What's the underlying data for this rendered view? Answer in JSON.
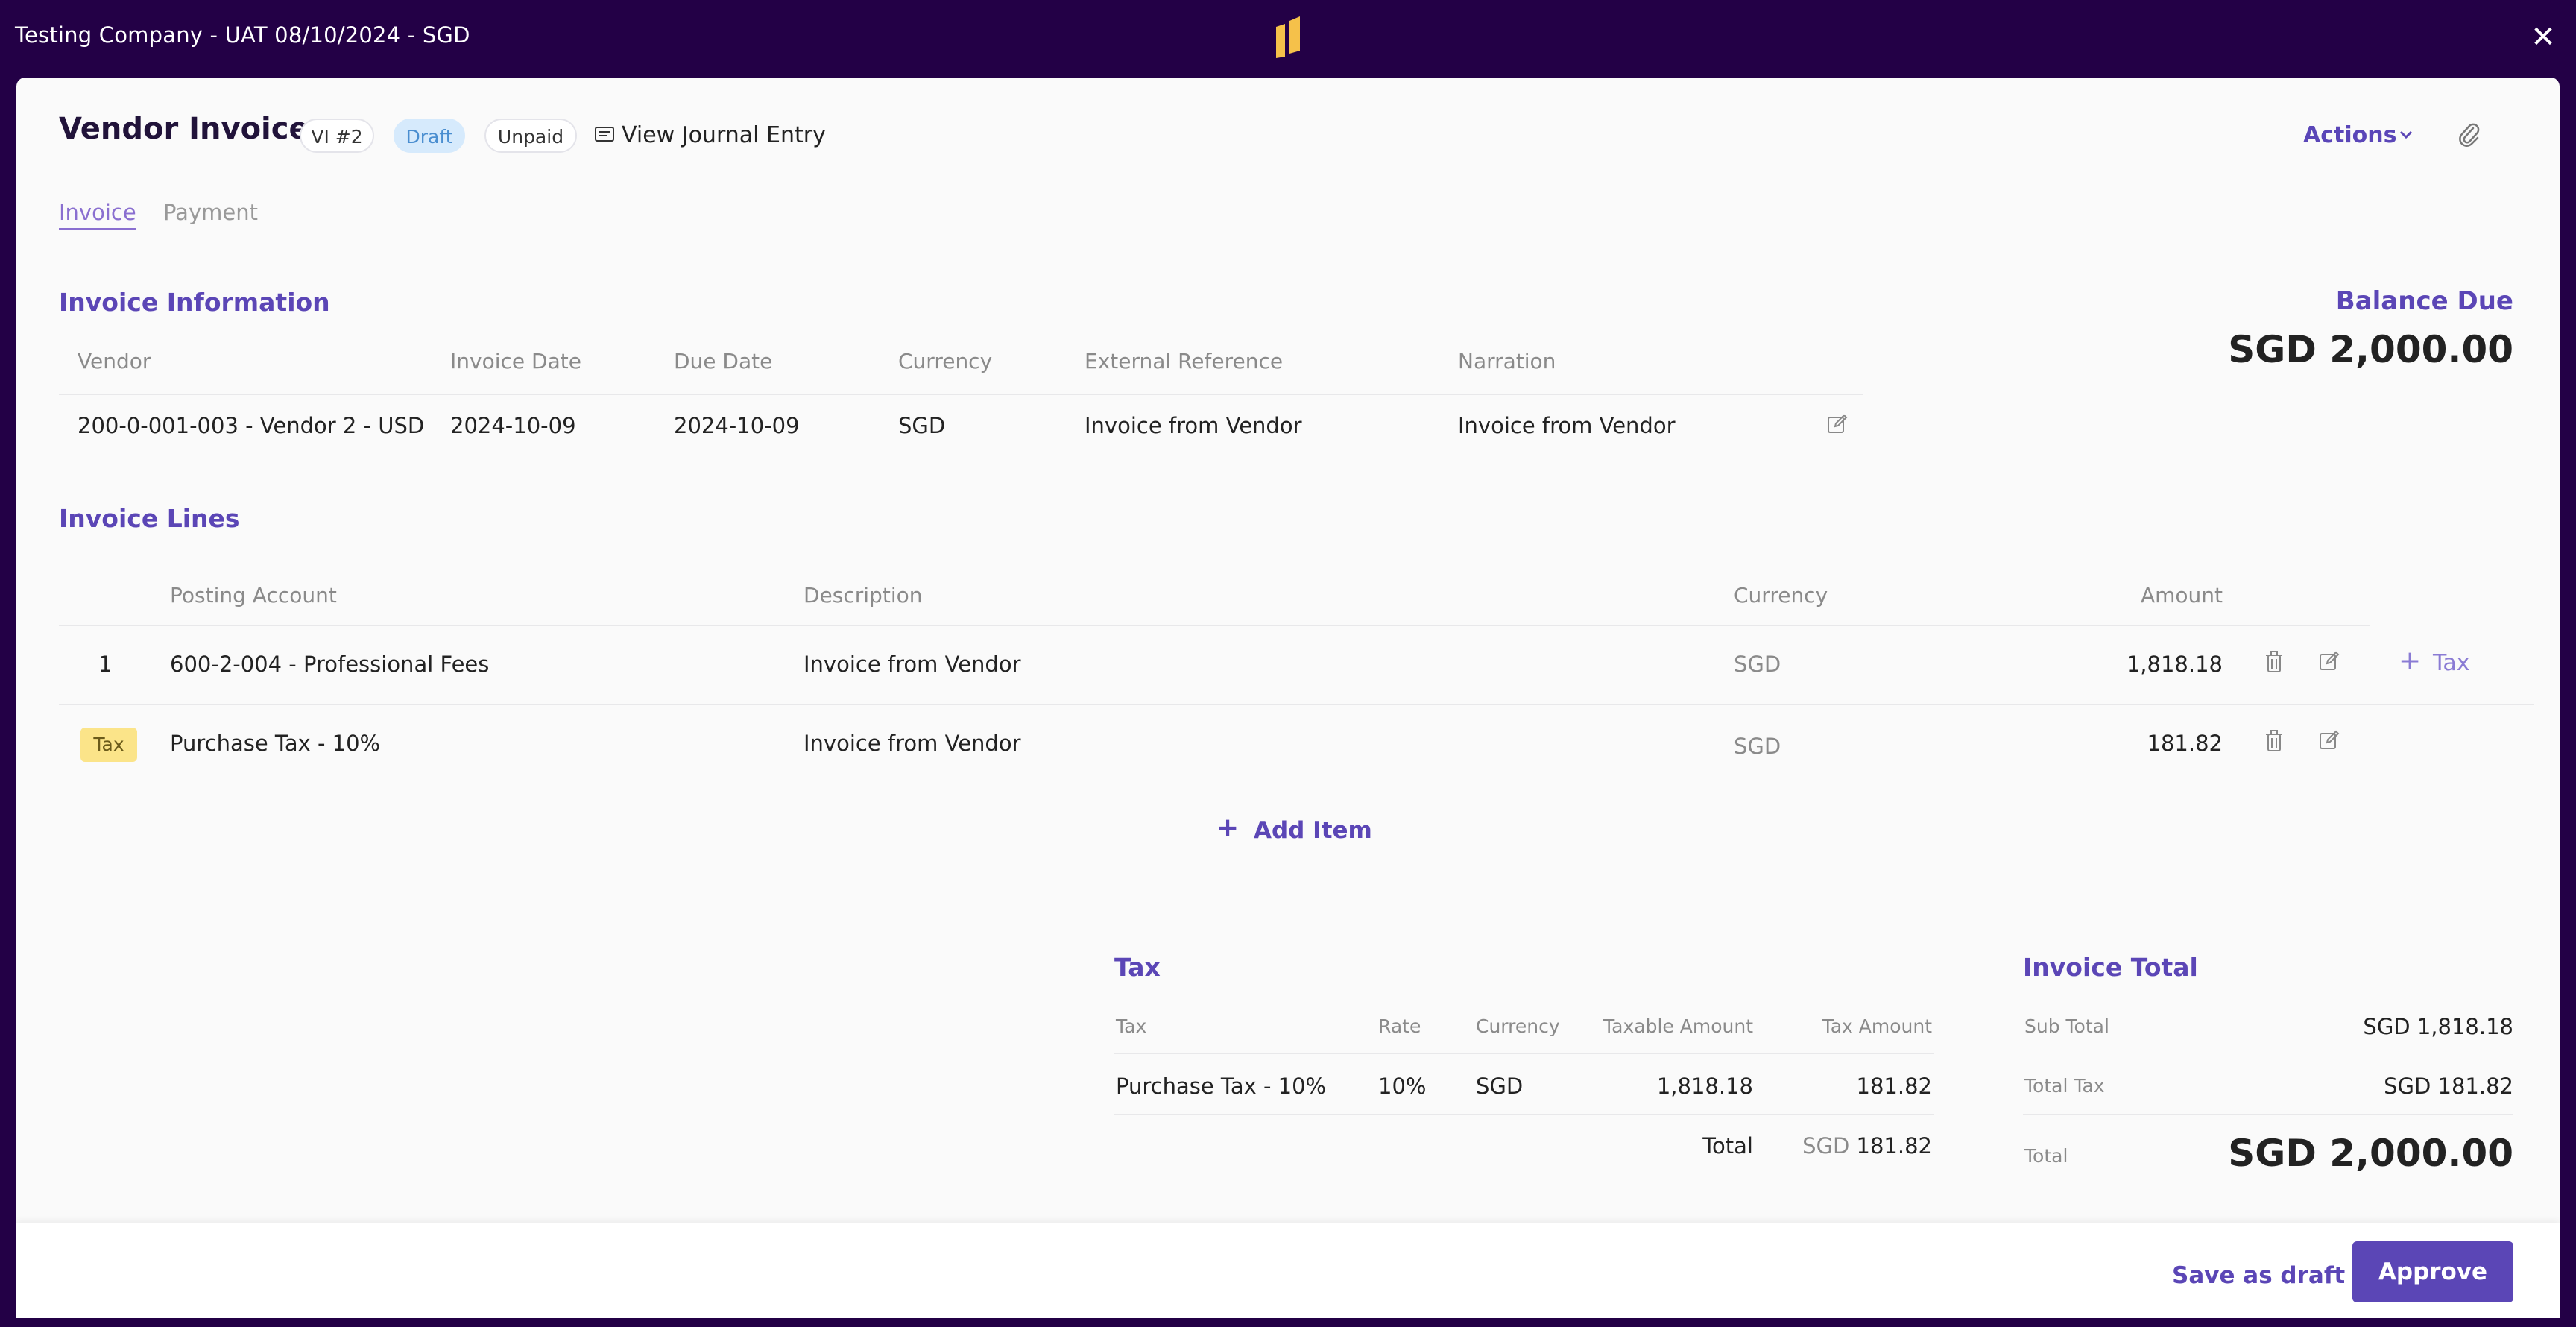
{
  "window": {
    "title": "Testing Company - UAT 08/10/2024 - SGD",
    "logo_icon": "app-logo-icon",
    "close_icon": "close-icon",
    "close_glyph": "✕"
  },
  "header": {
    "title": "Vendor Invoice",
    "number_badge": "VI #2",
    "status_badge": "Draft",
    "payment_badge": "Unpaid",
    "journal_link": "View Journal Entry",
    "actions_label": "Actions"
  },
  "tabs": [
    {
      "label": "Invoice",
      "active": true
    },
    {
      "label": "Payment",
      "active": false
    }
  ],
  "invoice_info": {
    "section_title": "Invoice Information",
    "columns": [
      "Vendor",
      "Invoice Date",
      "Due Date",
      "Currency",
      "External Reference",
      "Narration"
    ],
    "row": {
      "vendor": "200-0-001-003 - Vendor 2 - USD",
      "invoice_date": "2024-10-09",
      "due_date": "2024-10-09",
      "currency": "SGD",
      "external_reference": "Invoice from Vendor",
      "narration": "Invoice from Vendor"
    }
  },
  "balance": {
    "label": "Balance Due",
    "value": "SGD 2,000.00"
  },
  "invoice_lines": {
    "section_title": "Invoice Lines",
    "columns": [
      "Posting Account",
      "Description",
      "Currency",
      "Amount"
    ],
    "rows": [
      {
        "index": "1",
        "account": "600-2-004 - Professional Fees",
        "description": "Invoice from Vendor",
        "currency": "SGD",
        "amount": "1,818.18",
        "add_tax": "Tax"
      },
      {
        "badge": "Tax",
        "account": "Purchase Tax - 10%",
        "description": "Invoice from Vendor",
        "currency": "SGD",
        "amount": "181.82"
      }
    ],
    "add_item_label": "Add Item"
  },
  "tax_summary": {
    "section_title": "Tax",
    "columns": [
      "Tax",
      "Rate",
      "Currency",
      "Taxable Amount",
      "Tax Amount"
    ],
    "row": {
      "tax": "Purchase Tax - 10%",
      "rate": "10%",
      "currency": "SGD",
      "taxable_amount": "1,818.18",
      "tax_amount": "181.82"
    },
    "total_label": "Total",
    "total_currency": "SGD",
    "total_value": "181.82"
  },
  "invoice_total": {
    "section_title": "Invoice Total",
    "sub_total_label": "Sub Total",
    "sub_total_value": "SGD 1,818.18",
    "total_tax_label": "Total Tax",
    "total_tax_value": "SGD 181.82",
    "total_label": "Total",
    "total_value": "SGD 2,000.00"
  },
  "footer": {
    "save_draft_label": "Save as draft",
    "approve_label": "Approve"
  },
  "colors": {
    "brand": "#230046",
    "accent": "#5b46b6",
    "logo": "#f5c14a",
    "tax_badge": "#fbe489",
    "draft_badge": "#d6eafc"
  }
}
